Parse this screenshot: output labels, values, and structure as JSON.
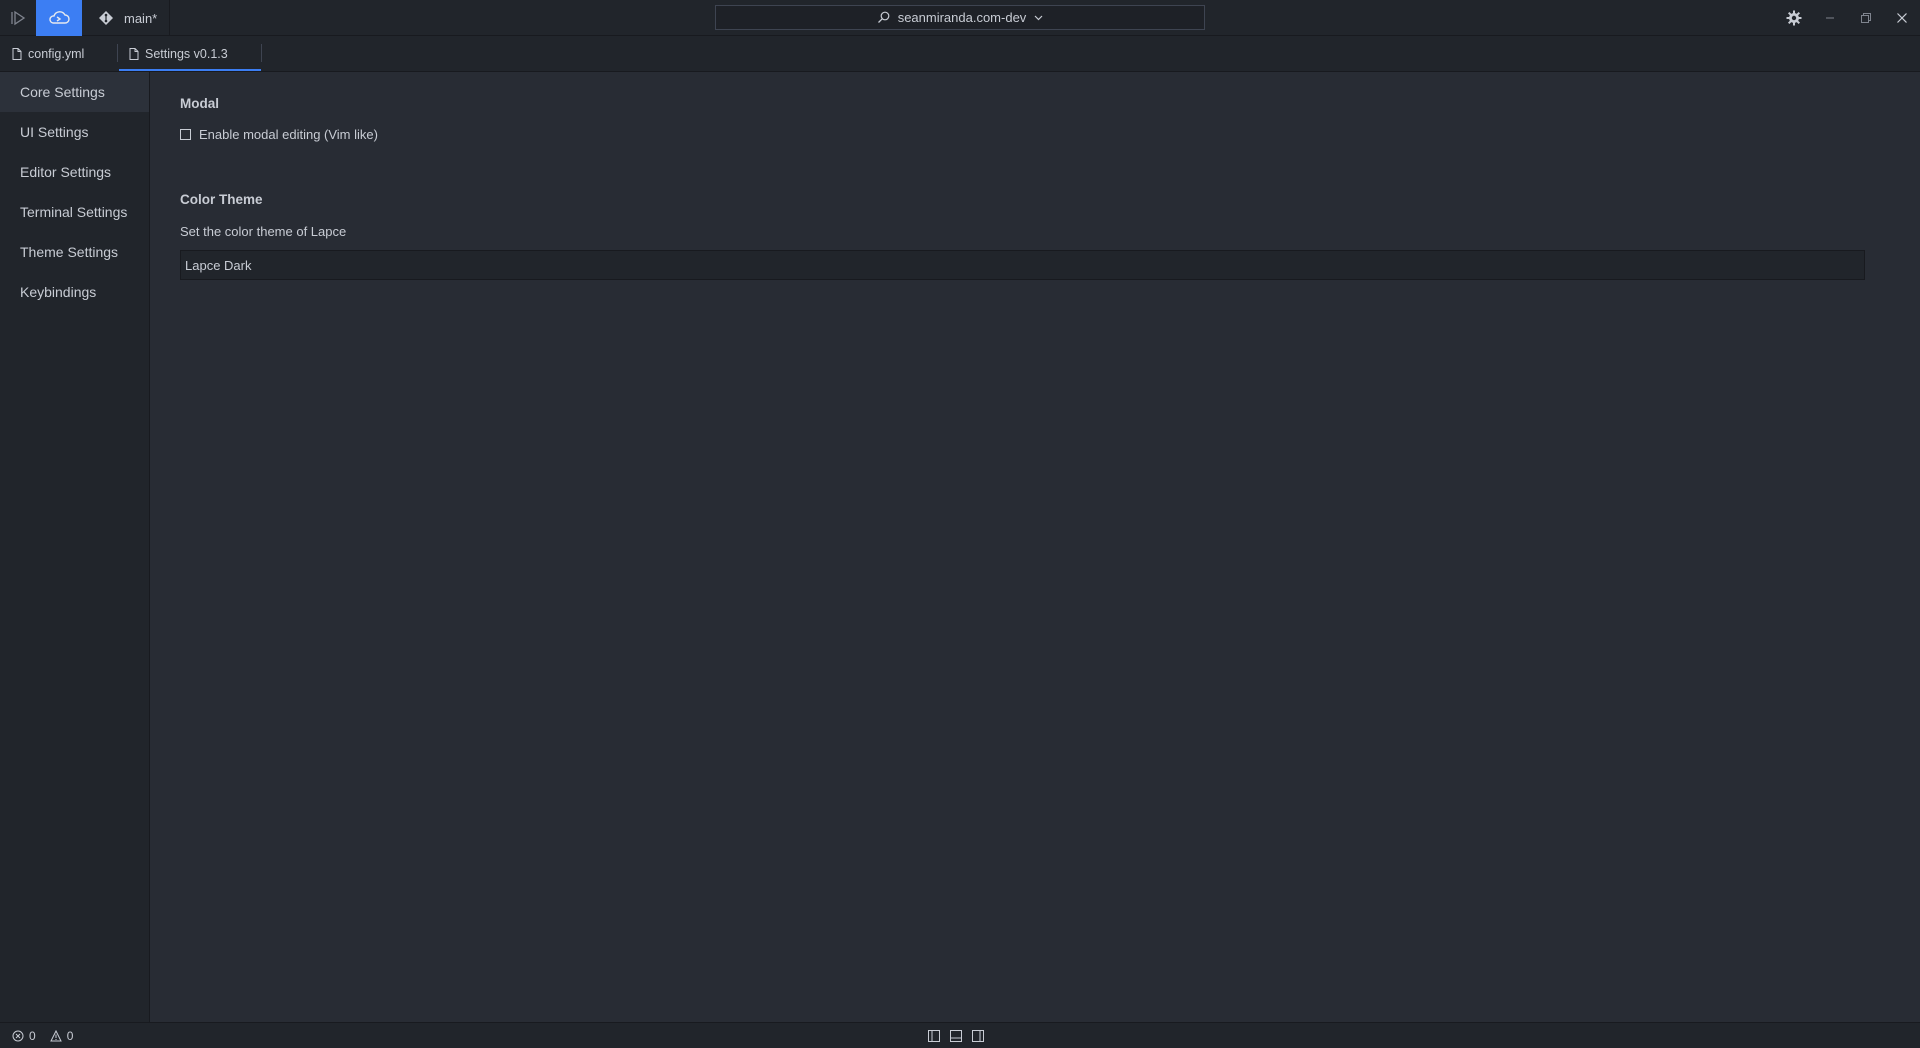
{
  "titlebar": {
    "branch": "main*",
    "search_label": "seanmiranda.com-dev"
  },
  "tabs": [
    {
      "label": "config.yml",
      "active": false
    },
    {
      "label": "Settings v0.1.3",
      "active": true
    }
  ],
  "sidebar": {
    "items": [
      {
        "label": "Core Settings",
        "active": true
      },
      {
        "label": "UI Settings"
      },
      {
        "label": "Editor Settings"
      },
      {
        "label": "Terminal Settings"
      },
      {
        "label": "Theme Settings"
      },
      {
        "label": "Keybindings"
      }
    ]
  },
  "main": {
    "modal": {
      "title": "Modal",
      "checkbox_label": "Enable modal editing (Vim like)",
      "checked": false
    },
    "color_theme": {
      "title": "Color Theme",
      "description": "Set the color theme of Lapce",
      "value": "Lapce Dark"
    }
  },
  "statusbar": {
    "errors": "0",
    "warnings": "0"
  },
  "colors": {
    "accent": "#3c7ef3",
    "background": "#282c34",
    "panel": "#21252b",
    "text": "#c8ccd4"
  },
  "icons": [
    "run-icon",
    "remote-icon",
    "git-branch-icon",
    "search-icon",
    "chevron-down-icon",
    "gear-icon",
    "minimize-icon",
    "restore-icon",
    "close-icon",
    "file-icon",
    "error-icon",
    "warning-icon",
    "left-panel-icon",
    "bottom-panel-icon",
    "right-panel-icon"
  ]
}
